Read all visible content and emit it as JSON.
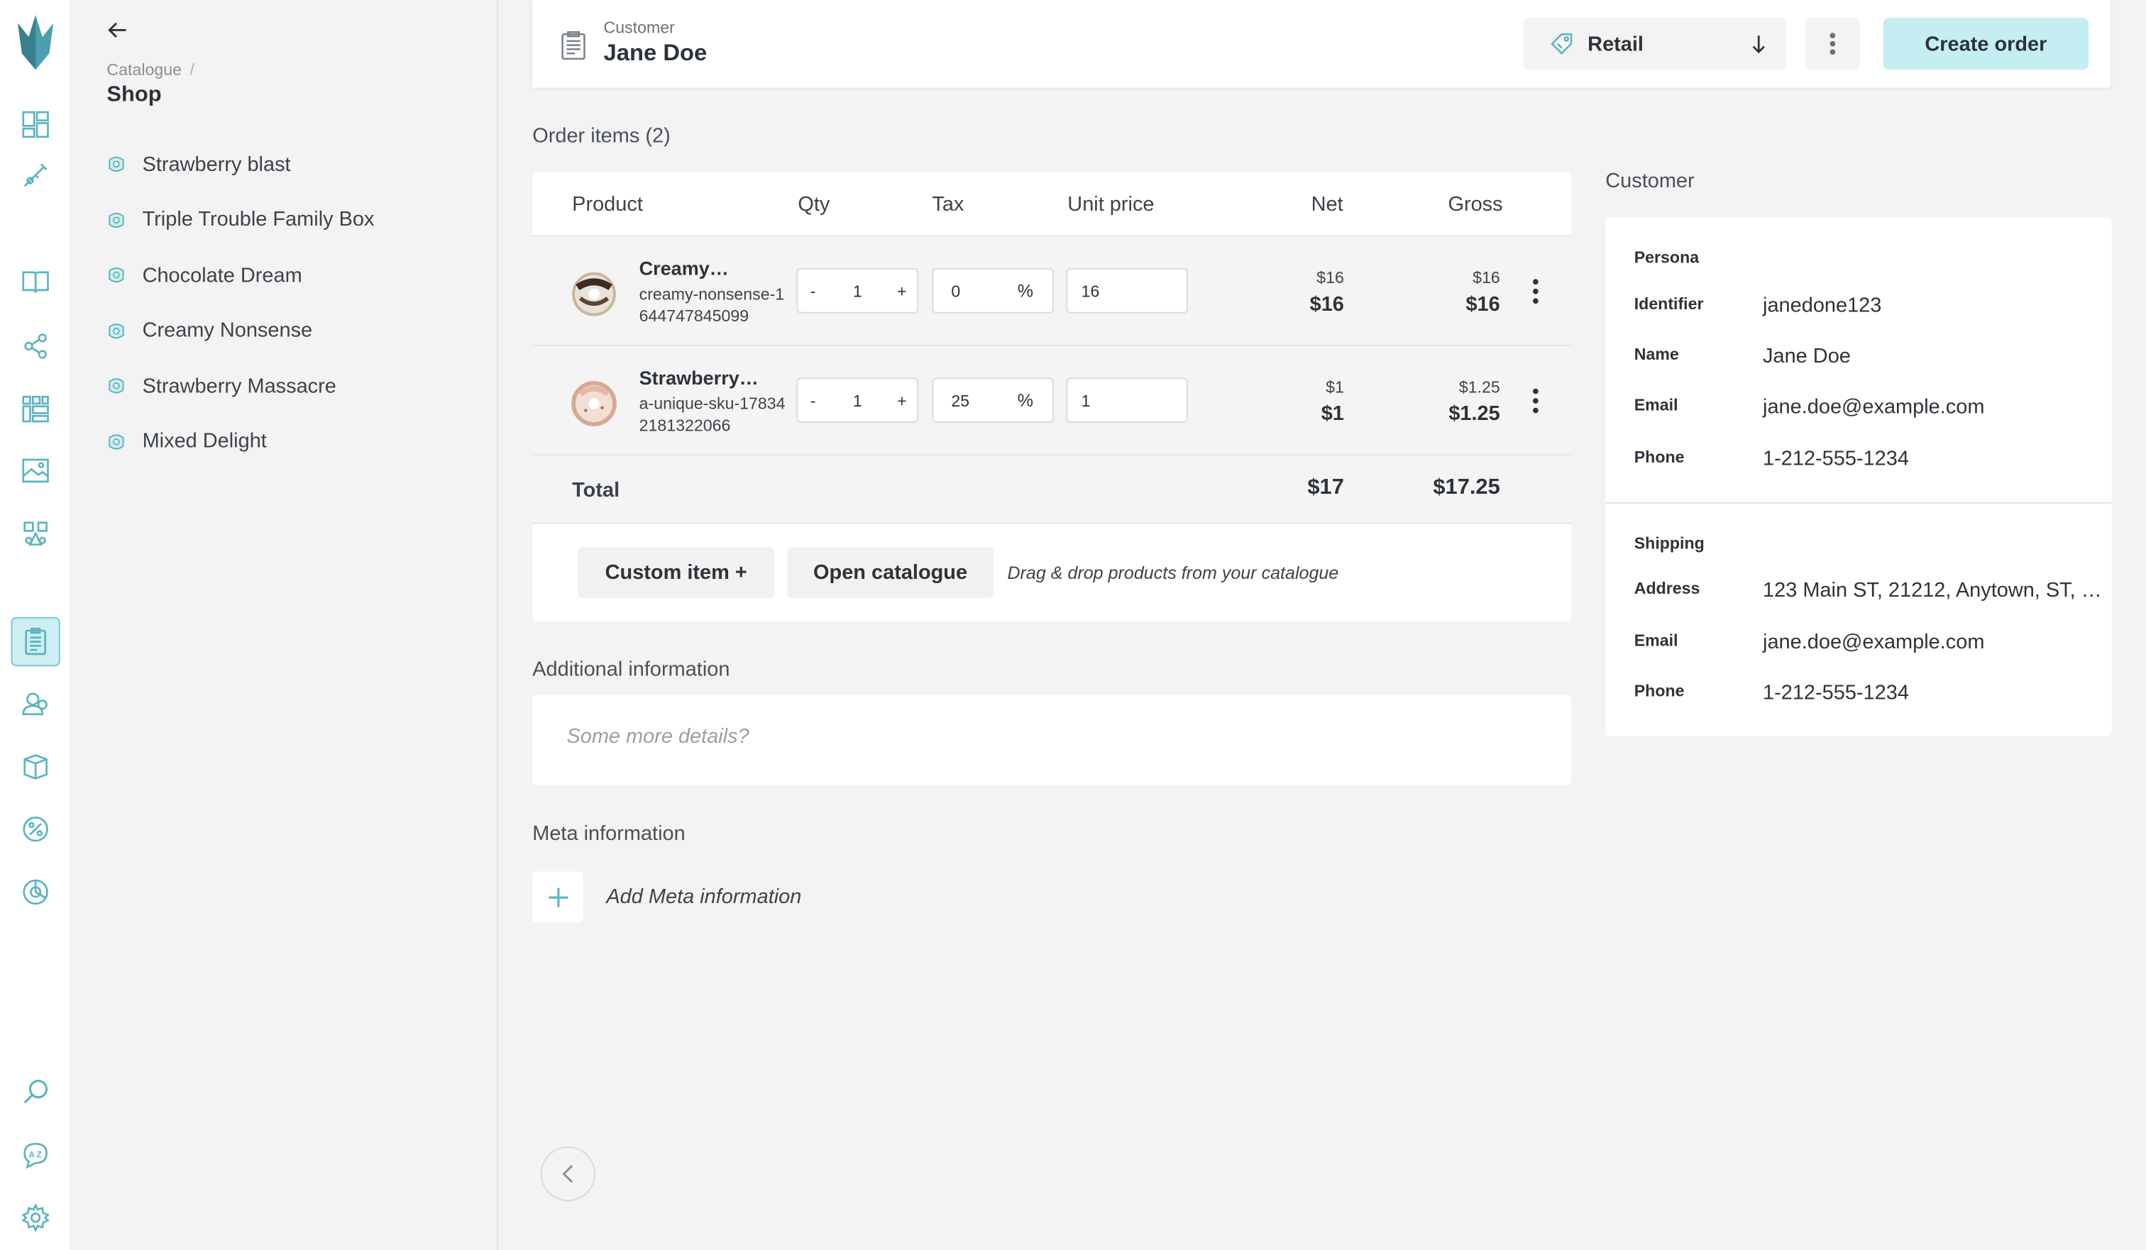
{
  "header": {
    "customer_label": "Customer",
    "customer_name": "Jane Doe",
    "price_variant": "Retail",
    "create_label": "Create order"
  },
  "catalogue": {
    "breadcrumb_root": "Catalogue",
    "breadcrumb_sep": "/",
    "title": "Shop",
    "items": [
      {
        "label": "Strawberry blast"
      },
      {
        "label": "Triple Trouble Family Box"
      },
      {
        "label": "Chocolate Dream"
      },
      {
        "label": "Creamy Nonsense"
      },
      {
        "label": "Strawberry Massacre"
      },
      {
        "label": "Mixed Delight"
      }
    ]
  },
  "rail": {
    "icons": [
      "dashboard-icon",
      "usage-icon",
      "catalogue-icon",
      "graph-icon",
      "grid-icon",
      "media-icon",
      "shapes-icon",
      "orders-icon",
      "customers-icon",
      "stock-icon",
      "discount-icon",
      "reports-icon",
      "search-icon",
      "translate-icon",
      "settings-icon"
    ],
    "accent": "#5ab4c0"
  },
  "order": {
    "heading": "Order items (2)",
    "columns": {
      "product": "Product",
      "qty": "Qty",
      "tax": "Tax",
      "unit_price": "Unit price",
      "net": "Net",
      "gross": "Gross"
    },
    "rows": [
      {
        "name": "Creamy…",
        "sku": "creamy-nonsense-1644747845099",
        "qty": "1",
        "qty_minus": "-",
        "qty_plus": "+",
        "tax": "0",
        "tax_unit": "%",
        "unit_price": "16",
        "net_small": "$16",
        "net": "$16",
        "gross_small": "$16",
        "gross": "$16"
      },
      {
        "name": "Strawberry…",
        "sku": "a-unique-sku-178342181322066",
        "qty": "1",
        "qty_minus": "-",
        "qty_plus": "+",
        "tax": "25",
        "tax_unit": "%",
        "unit_price": "1",
        "net_small": "$1",
        "net": "$1",
        "gross_small": "$1.25",
        "gross": "$1.25"
      }
    ],
    "total_label": "Total",
    "total_net": "$17",
    "total_gross": "$17.25",
    "custom_item_label": "Custom item +",
    "open_catalogue_label": "Open catalogue",
    "drag_hint": "Drag & drop products from your catalogue"
  },
  "additional": {
    "heading": "Additional information",
    "placeholder": "Some more details?"
  },
  "meta": {
    "heading": "Meta information",
    "add_label": "Add Meta information"
  },
  "customer": {
    "heading": "Customer",
    "persona_label": "Persona",
    "identifier_label": "Identifier",
    "identifier": "janedone123",
    "name_label": "Name",
    "name": "Jane Doe",
    "email_label": "Email",
    "email": "jane.doe@example.com",
    "phone_label": "Phone",
    "phone": "1-212-555-1234",
    "shipping_label": "Shipping",
    "address_label": "Address",
    "address": "123 Main ST, 21212, Anytown, ST, …",
    "ship_email_label": "Email",
    "ship_email": "jane.doe@example.com",
    "ship_phone_label": "Phone",
    "ship_phone": "1-212-555-1234"
  }
}
